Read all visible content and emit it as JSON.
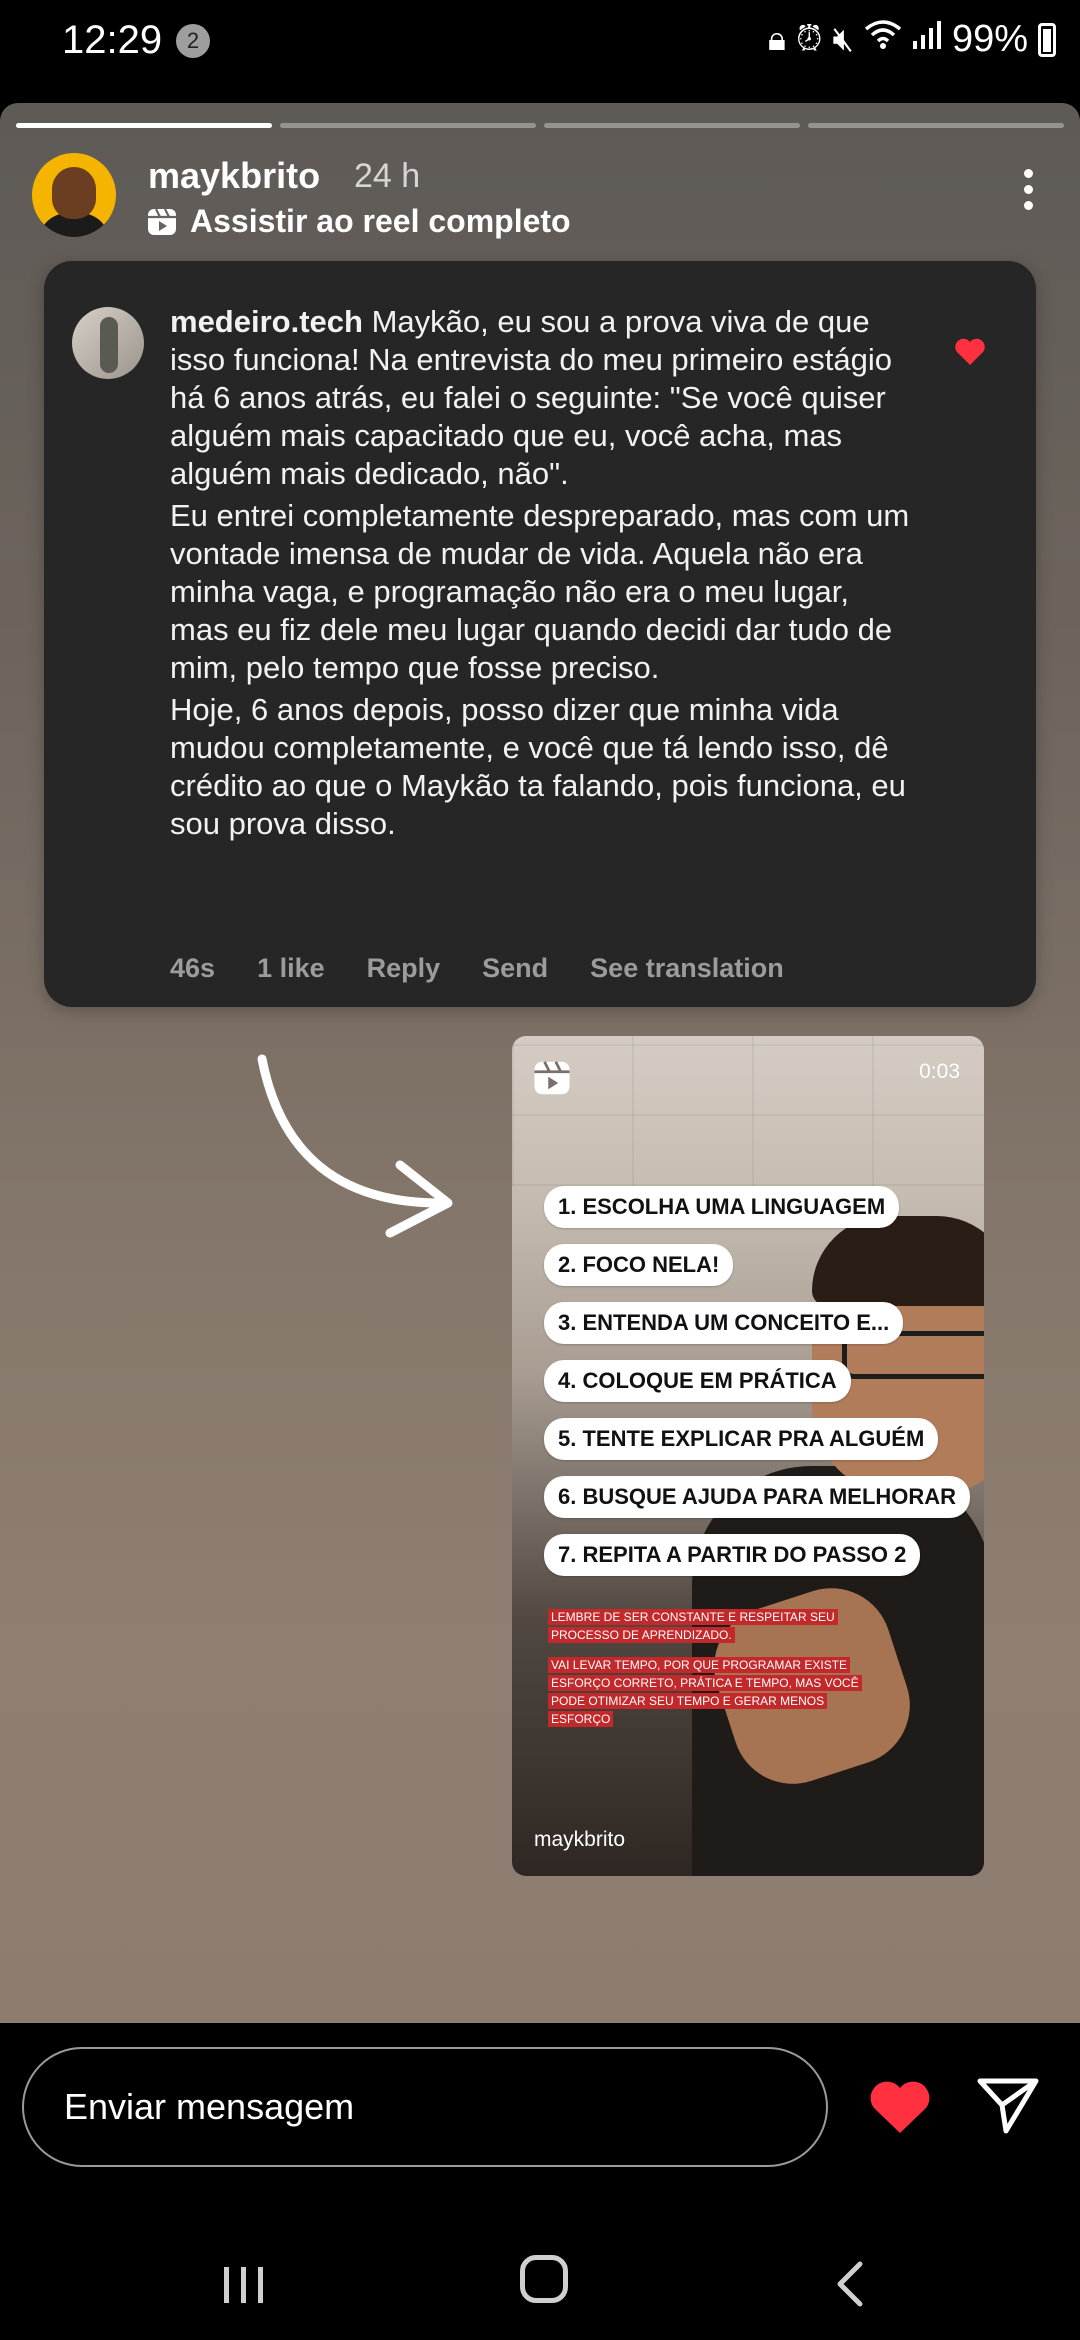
{
  "status_bar": {
    "time": "12:29",
    "notification_count": "2",
    "battery": "99%"
  },
  "story": {
    "progress": [
      1,
      0,
      0,
      0
    ],
    "username": "maykbrito",
    "time_ago": "24 h",
    "reel_link": "Assistir ao reel completo",
    "comment": {
      "username": "medeiro.tech",
      "paragraph1": "Maykão, eu sou a prova viva de que isso funciona! Na entrevista do meu primeiro estágio há 6 anos atrás, eu falei o seguinte: \"Se você quiser alguém mais capacitado que eu, você acha, mas alguém mais dedicado, não\".",
      "paragraph2": "Eu entrei completamente despreparado, mas com um vontade imensa de mudar de vida. Aquela não era minha vaga, e programação não era o meu lugar, mas eu fiz dele meu lugar quando decidi dar tudo de mim, pelo tempo que fosse preciso.",
      "paragraph3": "Hoje, 6 anos depois, posso dizer que minha vida mudou completamente, e você que tá lendo isso, dê crédito ao que o Maykão ta falando, pois funciona, eu sou prova disso.",
      "age": "46s",
      "likes": "1 like",
      "reply": "Reply",
      "send": "Send",
      "translate": "See translation"
    },
    "reel": {
      "duration": "0:03",
      "steps": [
        "1. ESCOLHA UMA LINGUAGEM",
        "2. FOCO NELA!",
        "3. ENTENDA UM CONCEITO E...",
        "4. COLOQUE EM PRÁTICA",
        "5. TENTE EXPLICAR PRA ALGUÉM",
        "6. BUSQUE AJUDA PARA MELHORAR",
        "7. REPITA A PARTIR DO PASSO 2"
      ],
      "note1": "LEMBRE DE SER CONSTANTE E RESPEITAR SEU PROCESSO DE APRENDIZADO.",
      "note2": "VAI LEVAR TEMPO, POR QUE PROGRAMAR EXISTE ESFORÇO CORRETO, PRÁTICA E TEMPO, MAS VOCÊ PODE OTIMIZAR SEU TEMPO E GERAR MENOS ESFORÇO",
      "watermark": "maykbrito"
    }
  },
  "bottom_bar": {
    "message_placeholder": "Enviar mensagem"
  },
  "colors": {
    "like_red": "#ff3040",
    "card_bg": "#262626"
  }
}
